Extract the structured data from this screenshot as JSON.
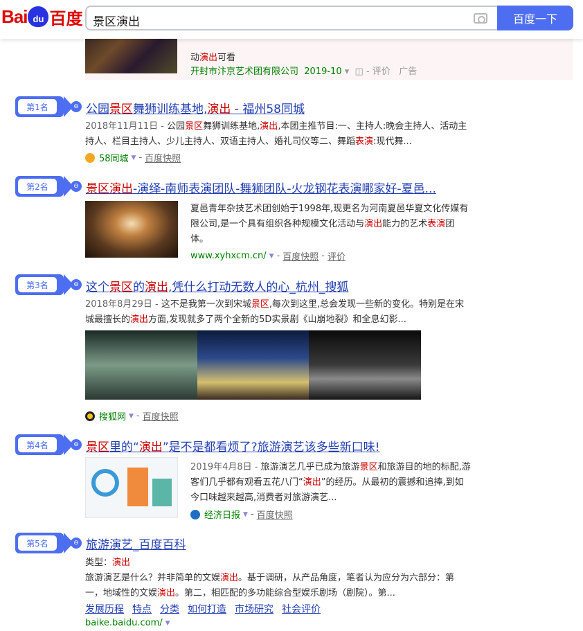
{
  "header": {
    "logo_text_en": "Bai",
    "logo_paw_text": "du",
    "logo_text_cn": "百度",
    "query": "景区演出",
    "search_button": "百度一下"
  },
  "ad": {
    "text_prefix": "动",
    "text_em": "演出",
    "text_suffix": "可看",
    "company": "开封市汴京艺术团有限公司",
    "date": "2019-10",
    "review": "评价",
    "ad_label": "广告"
  },
  "results": [
    {
      "rank": "第1名",
      "title_pre": "公园",
      "title_em1": "景区",
      "title_mid": "舞狮训练基地,",
      "title_em2": "演出",
      "title_post": " - 福州58同城",
      "date": "2018年11月11日 - ",
      "abs_line1_pre": "公园",
      "abs_line1_em": "景区",
      "abs_line1_mid": "舞狮训练基地,",
      "abs_line1_em2": "演出",
      "abs_line1_post": ",本团主推节目:一、主持人:晚会主持人、活动主",
      "abs_line2_pre": "持人、栏目主持人、少儿主持人、双语主持人、婚礼司仪等二、舞蹈",
      "abs_line2_em": "表演",
      "abs_line2_post": ":现代舞...",
      "source": "58同城",
      "snapshot": "百度快照"
    },
    {
      "rank": "第2名",
      "title_em1": "景区演出",
      "title_post": "-演绎-南师表演团队-舞狮团队-火龙钢花表演哪家好-夏邑...",
      "abs_line1": "夏邑青年杂技艺术团创始于1998年,现更名为河南夏邑华夏文化传媒有",
      "abs_line2_pre": "限公司,是一个具有组织各种规模文化活动与",
      "abs_line2_em": "演出",
      "abs_line2_mid": "能力的艺术",
      "abs_line2_em2": "表演",
      "abs_line2_post": "团",
      "abs_line3": "体。",
      "source": "www.xyhxcm.cn/",
      "snapshot": "百度快照",
      "review": "评价"
    },
    {
      "rank": "第3名",
      "title_pre": "这个",
      "title_em1": "景区",
      "title_mid": "的",
      "title_em2": "演出",
      "title_post": ",凭什么打动无数人的心_杭州_搜狐",
      "date": "2018年8月29日 - ",
      "abs_line1_pre": "这不是我第一次到宋城",
      "abs_line1_em": "景区",
      "abs_line1_post": ",每次到这里,总会发现一些新的变化。特别是在宋",
      "abs_line2_pre": "城最擅长的",
      "abs_line2_em": "演出",
      "abs_line2_post": "方面,发现就多了两个全新的5D实景剧《山崩地裂》和全息幻影...",
      "source": "搜狐网",
      "snapshot": "百度快照"
    },
    {
      "rank": "第4名",
      "title_em1": "景区",
      "title_mid": "里的“",
      "title_em2": "演出",
      "title_post": "”是不是都看烦了?旅游演艺该多些新口味!",
      "date": "2019年4月8日 - ",
      "abs_line1_pre": "旅游演艺几乎已成为旅游",
      "abs_line1_em": "景区",
      "abs_line1_post": "和旅游目的地的标配,游",
      "abs_line2_pre": "客们几乎都有观看五花八门“",
      "abs_line2_em": "演出",
      "abs_line2_post": "”的经历。从最初的震撼和追捧,到如",
      "abs_line3": "今口味越来越高,消费者对旅游演艺...",
      "source": "经济日报",
      "snapshot": "百度快照"
    },
    {
      "rank": "第5名",
      "title": "旅游演艺_百度百科",
      "type_label": "类型：",
      "type_value": "演出",
      "abs_line1_pre": "旅游演艺是什么？并非简单的文娱",
      "abs_line1_em": "演出",
      "abs_line1_post": "。基于调研，从产品角度，笔者认为应分为六部分：第",
      "abs_line2_pre": "一，地域性的文娱",
      "abs_line2_em": "演出",
      "abs_line2_post": "。第二，相匹配的多功能综合型娱乐剧场（剧院）。第...",
      "sublinks": [
        "发展历程",
        "特点",
        "分类",
        "如何打造",
        "市场研究",
        "社会评价"
      ],
      "source": "baike.baidu.com/"
    }
  ]
}
